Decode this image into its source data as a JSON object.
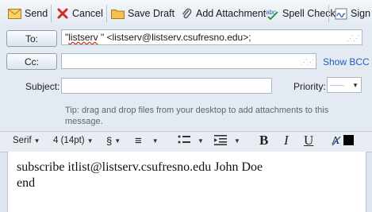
{
  "toolbar": {
    "send": "Send",
    "cancel": "Cancel",
    "save_draft": "Save Draft",
    "add_attachment": "Add Attachment",
    "spell_check": "Spell Check",
    "signature": "Sign"
  },
  "header": {
    "to_label": "To:",
    "to_value_prefix": "\"",
    "to_value_name": "listserv",
    "to_value_rest": " \" <listserv@listserv.csufresno.edu>;",
    "cc_label": "Cc:",
    "cc_value": "",
    "show_bcc": "Show BCC",
    "subject_label": "Subject:",
    "subject_value": "",
    "priority_label": "Priority:",
    "priority_value": "——",
    "tip": "Tip: drag and drop files from your desktop to add attachments to this message."
  },
  "format": {
    "font": "Serif",
    "size": "4 (14pt)",
    "paragraph": "§",
    "align": "≡",
    "bold": "B",
    "italic": "I",
    "underline": "U"
  },
  "body": {
    "line1": "subscribe itlist@listserv.csufresno.edu  John Doe",
    "line2": "end"
  },
  "colors": {
    "send_icon": "#e0a020",
    "cancel_icon": "#d22b1f",
    "link": "#1f5fbf"
  }
}
